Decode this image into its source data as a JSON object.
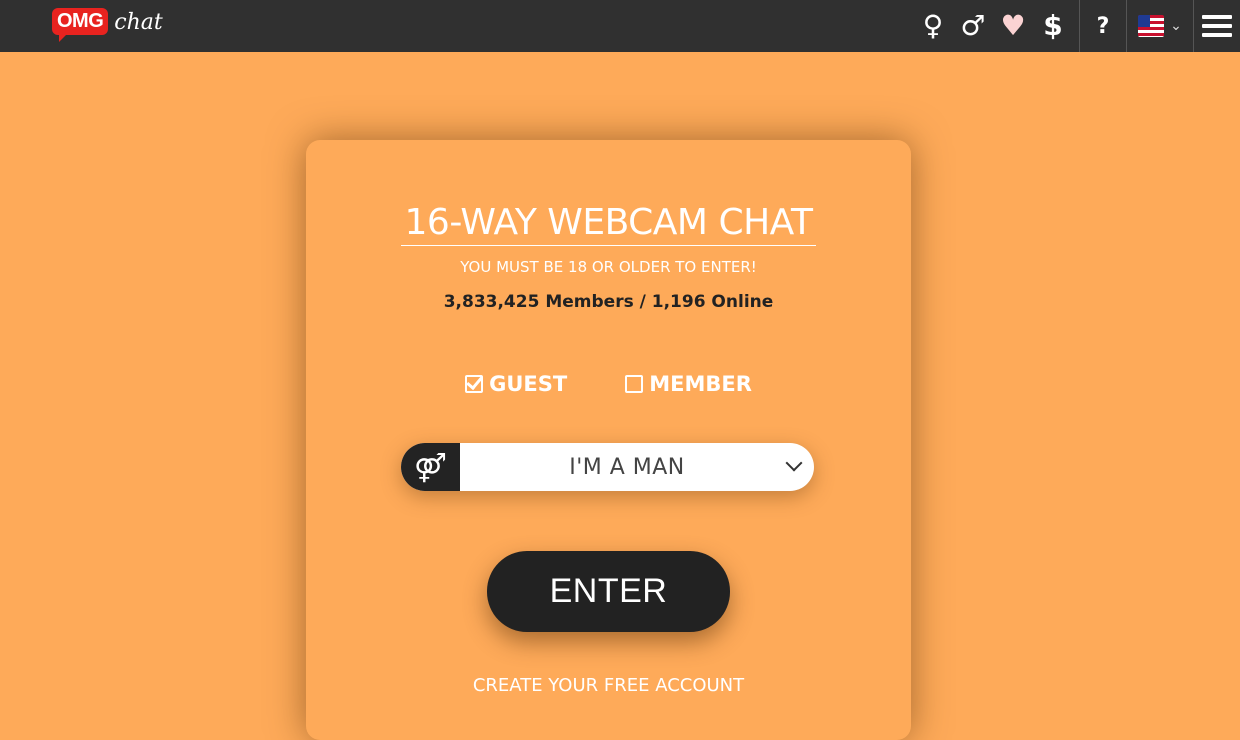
{
  "header": {
    "logo_badge": "OMG",
    "logo_word": "chat",
    "icons": {
      "female": "♀",
      "male": "♂",
      "heart": "♥",
      "dollar": "$",
      "help": "?"
    }
  },
  "card": {
    "title": "16-WAY WEBCAM CHAT",
    "subtitle": "YOU MUST BE 18 OR OLDER TO ENTER!",
    "stats": "3,833,425 Members / 1,196 Online",
    "tabs": [
      {
        "label": "GUEST",
        "checked": true
      },
      {
        "label": "MEMBER",
        "checked": false
      }
    ],
    "gender_select": {
      "icon": "⚤",
      "value": "I'M A MAN"
    },
    "enter_label": "ENTER",
    "create_account": "CREATE YOUR FREE ACCOUNT"
  },
  "colors": {
    "background": "#FEAA59",
    "topbar": "#303030",
    "logo_red": "#E8231F",
    "dark_button": "#222222"
  }
}
